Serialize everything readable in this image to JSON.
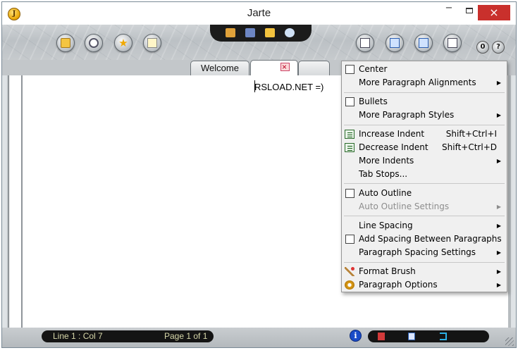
{
  "window": {
    "title": "Jarte",
    "app_icon_letter": "J",
    "minimize_glyph": "−",
    "close_glyph": "×"
  },
  "toolbar": {
    "left_buttons": [
      "open-folder-icon",
      "recent-clock-icon",
      "favorites-star-icon",
      "notepad-icon"
    ],
    "center_tools": [
      "insert-object-icon",
      "chart-icon",
      "folder-icon",
      "search-icon"
    ],
    "right_buttons": [
      "save-doc-icon",
      "print-preview-icon",
      "page-icon",
      "clipboard-icon"
    ],
    "mini_left": "0",
    "mini_right": "?"
  },
  "tabs": [
    {
      "label": "Welcome",
      "active": false
    },
    {
      "label": "",
      "active": true
    },
    {
      "label": "",
      "active": false
    }
  ],
  "editor": {
    "text": "RSLOAD.NET =)"
  },
  "status": {
    "position": "Line 1 : Col 7",
    "page": "Page 1 of 1",
    "info_glyph": "i"
  },
  "menu": {
    "items": [
      {
        "label": "Center",
        "kind": "check",
        "checked": false
      },
      {
        "label": "More Paragraph Alignments",
        "kind": "submenu"
      },
      {
        "label": "Bullets",
        "kind": "check",
        "checked": false
      },
      {
        "label": "More Paragraph Styles",
        "kind": "submenu"
      },
      {
        "label": "Increase Indent",
        "kind": "icon",
        "shortcut": "Shift+Ctrl+I"
      },
      {
        "label": "Decrease Indent",
        "kind": "icon",
        "shortcut": "Shift+Ctrl+D"
      },
      {
        "label": "More Indents",
        "kind": "submenu"
      },
      {
        "label": "Tab Stops...",
        "kind": "plain"
      },
      {
        "label": "Auto Outline",
        "kind": "check",
        "checked": false
      },
      {
        "label": "Auto Outline Settings",
        "kind": "submenu",
        "disabled": true
      },
      {
        "label": "Line Spacing",
        "kind": "submenu"
      },
      {
        "label": "Add Spacing Between Paragraphs",
        "kind": "check",
        "checked": false
      },
      {
        "label": "Paragraph Spacing Settings",
        "kind": "submenu"
      },
      {
        "label": "Format Brush",
        "kind": "submenu"
      },
      {
        "label": "Paragraph Options",
        "kind": "submenu"
      }
    ],
    "submenu_arrow": "▶"
  },
  "colors": {
    "close_button": "#c9302c",
    "status_pill": "#141414",
    "status_text": "#d6d6a8"
  }
}
